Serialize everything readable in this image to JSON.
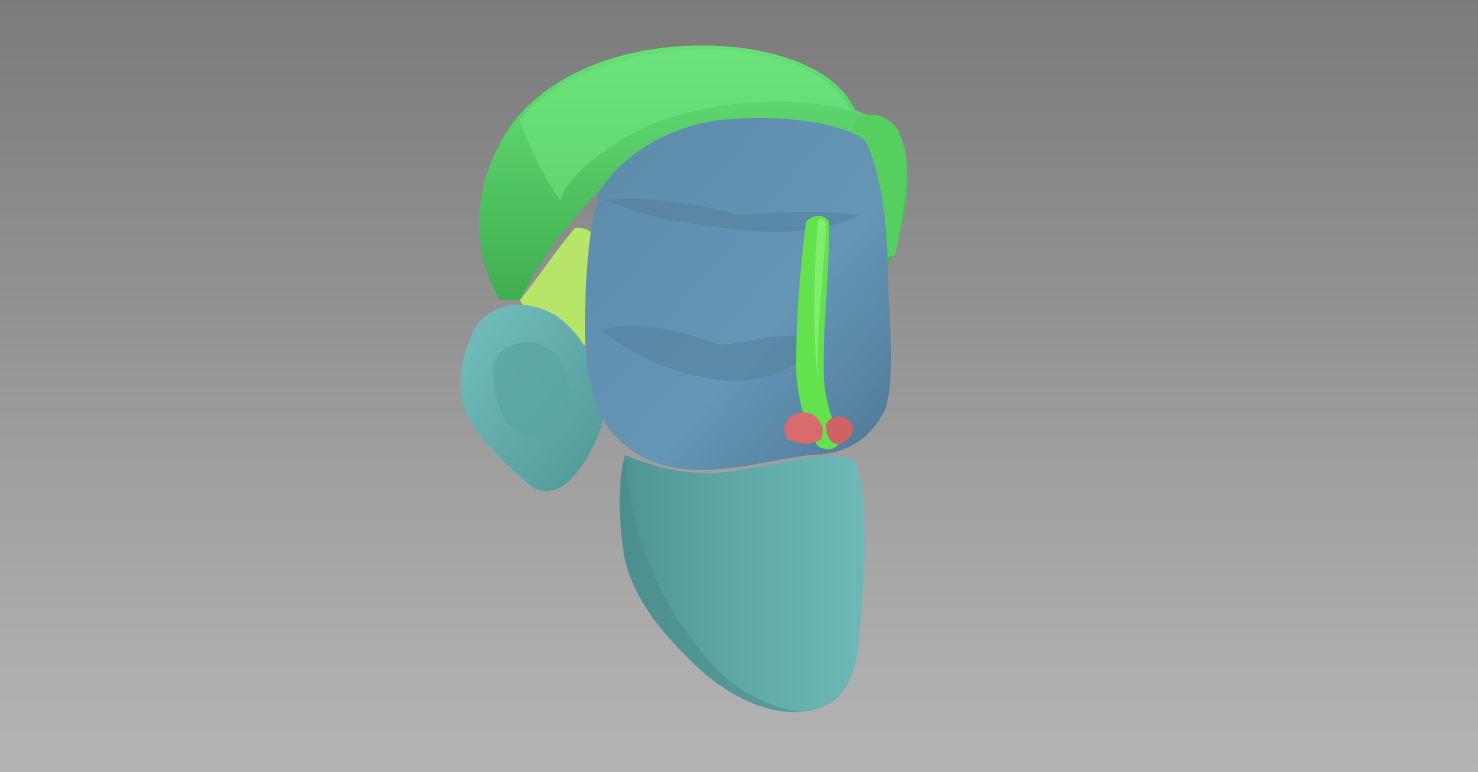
{
  "scene": {
    "subject": "sculpted-head-blockout",
    "background_top": "#7b7b7b",
    "background_bottom": "#b4b4b4",
    "colors": {
      "hair": "#5bd66b",
      "hair_shadow": "#38a84c",
      "side_hair": "#b6e56a",
      "skull": "#5f8cab",
      "skull_shadow": "#4b7590",
      "jaw": "#5fa9a7",
      "jaw_shadow": "#4c8e8d",
      "ear": "#67b3b1",
      "nose_bridge": "#63e24e",
      "nostril": "#d86c6c"
    }
  }
}
